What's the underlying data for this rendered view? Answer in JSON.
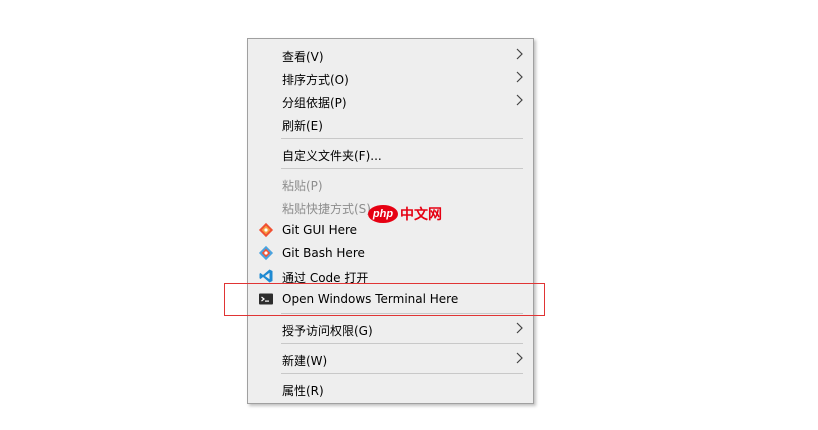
{
  "menu": {
    "items": [
      {
        "label": "查看(V)",
        "submenu": true
      },
      {
        "label": "排序方式(O)",
        "submenu": true
      },
      {
        "label": "分组依据(P)",
        "submenu": true
      },
      {
        "label": "刷新(E)"
      },
      {
        "label": "自定义文件夹(F)..."
      },
      {
        "label": "粘贴(P)",
        "disabled": true
      },
      {
        "label": "粘贴快捷方式(S)",
        "disabled": true
      },
      {
        "label": "Git GUI Here",
        "icon": "git-gui-icon"
      },
      {
        "label": "Git Bash Here",
        "icon": "git-bash-icon"
      },
      {
        "label": "通过 Code 打开",
        "icon": "vscode-icon"
      },
      {
        "label": "Open Windows Terminal Here",
        "icon": "terminal-icon"
      },
      {
        "label": "授予访问权限(G)",
        "submenu": true
      },
      {
        "label": "新建(W)",
        "submenu": true
      },
      {
        "label": "属性(R)"
      }
    ]
  },
  "watermark": {
    "logo": "php",
    "text": "中文网"
  },
  "colors": {
    "highlight_border": "#e03434",
    "watermark": "#e60012"
  }
}
